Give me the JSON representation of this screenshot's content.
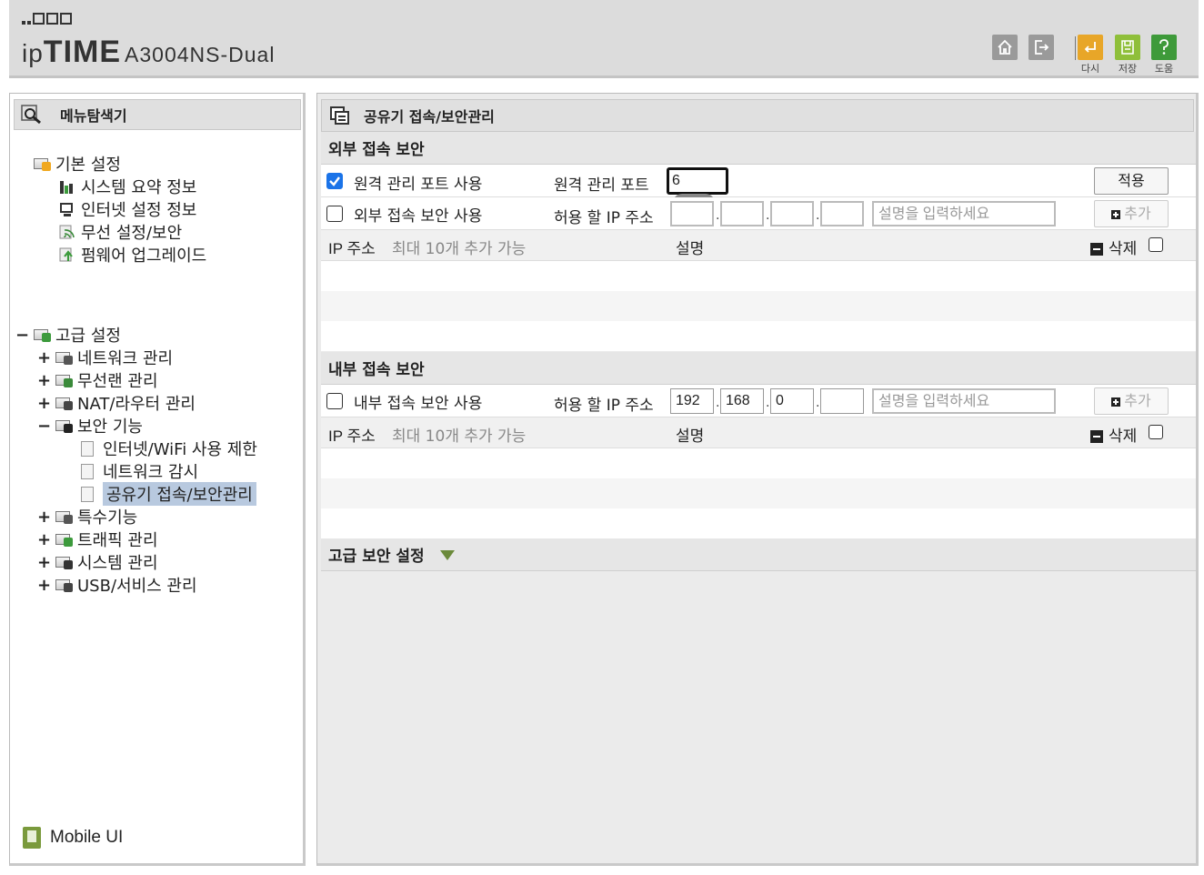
{
  "header": {
    "brand_prefix": "ip",
    "brand_main": "TIME",
    "model": "A3004NS-Dual",
    "buttons": [
      {
        "icon": "home-icon",
        "label": ""
      },
      {
        "icon": "logout-icon",
        "label": ""
      },
      {
        "icon": "redo-icon",
        "label": "다시"
      },
      {
        "icon": "save-icon",
        "label": "저장"
      },
      {
        "icon": "help-icon",
        "label": "도움"
      }
    ]
  },
  "sidebar": {
    "title": "메뉴탐색기",
    "basic": {
      "label": "기본 설정",
      "items": [
        "시스템 요약 정보",
        "인터넷 설정 정보",
        "무선 설정/보안",
        "펌웨어 업그레이드"
      ]
    },
    "advanced": {
      "label": "고급 설정",
      "toggle": "−",
      "items": [
        {
          "label": "네트워크 관리",
          "toggle": "+"
        },
        {
          "label": "무선랜 관리",
          "toggle": "+"
        },
        {
          "label": "NAT/라우터 관리",
          "toggle": "+"
        },
        {
          "label": "보안 기능",
          "toggle": "−"
        },
        {
          "label": "특수기능",
          "toggle": "+"
        },
        {
          "label": "트래픽 관리",
          "toggle": "+"
        },
        {
          "label": "시스템 관리",
          "toggle": "+"
        },
        {
          "label": "USB/서비스 관리",
          "toggle": "+"
        }
      ],
      "security_children": [
        "인터넷/WiFi 사용 제한",
        "네트워크 감시",
        "공유기 접속/보안관리"
      ]
    },
    "mobile_ui": "Mobile UI"
  },
  "main": {
    "title": "공유기 접속/보안관리",
    "external": {
      "heading": "외부 접속 보안",
      "remote_checkbox_label": "원격 관리 포트 사용",
      "remote_checked": true,
      "remote_port_label": "원격 관리 포트",
      "remote_port_value": "6",
      "apply_label": "적용",
      "ext_checkbox_label": "외부 접속 보안 사용",
      "ext_checked": false,
      "allow_ip_label": "허용 할 IP 주소",
      "ip": [
        "",
        "",
        "",
        ""
      ],
      "desc_placeholder": "설명을 입력하세요",
      "add_label": "추가",
      "list_ip_label": "IP 주소",
      "list_hint": "최대 10개 추가 가능",
      "list_desc_label": "설명",
      "delete_label": "삭제"
    },
    "internal": {
      "heading": "내부 접속 보안",
      "checkbox_label": "내부 접속 보안 사용",
      "checked": false,
      "allow_ip_label": "허용 할 IP 주소",
      "ip": [
        "192",
        "168",
        "0",
        ""
      ],
      "desc_placeholder": "설명을 입력하세요",
      "add_label": "추가",
      "list_ip_label": "IP 주소",
      "list_hint": "최대 10개 추가 가능",
      "list_desc_label": "설명",
      "delete_label": "삭제"
    },
    "advanced_heading": "고급 보안 설정"
  }
}
